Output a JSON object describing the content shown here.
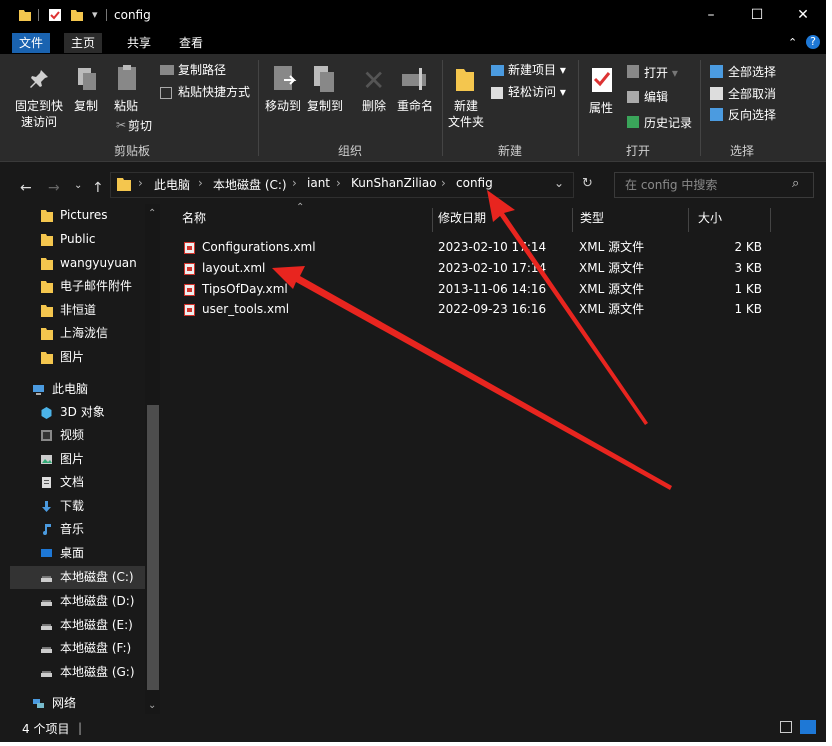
{
  "window": {
    "title": "config",
    "controls": [
      "–",
      "☐",
      "✕"
    ]
  },
  "menu": {
    "file": "文件",
    "home": "主页",
    "share": "共享",
    "view": "查看",
    "help": "?"
  },
  "ribbon": {
    "pin": "固定到快\n速访问",
    "copy": "复制",
    "paste": "粘贴",
    "copy_path": "复制路径",
    "paste_shortcut": "粘贴快捷方式",
    "cut": "剪切",
    "move_to": "移动到",
    "copy_to": "复制到",
    "delete": "删除",
    "rename": "重命名",
    "new_item": "新建项目",
    "easy_access": "轻松访问",
    "new_folder": "新建\n文件夹",
    "properties": "属性",
    "open": "打开",
    "edit": "编辑",
    "history": "历史记录",
    "select_all": "全部选择",
    "select_none": "全部取消",
    "invert": "反向选择",
    "groups": {
      "clipboard": "剪贴板",
      "organize": "组织",
      "new": "新建",
      "open": "打开",
      "select": "选择"
    }
  },
  "address": {
    "crumbs": [
      "此电脑",
      "本地磁盘 (C:)",
      "iant",
      "KunShanZiliao",
      "config"
    ],
    "search_placeholder": "在 config 中搜索"
  },
  "sidebar": {
    "items": [
      {
        "label": "Pictures",
        "icon": "folder-icon"
      },
      {
        "label": "Public",
        "icon": "folder-icon"
      },
      {
        "label": "wangyuyuan",
        "icon": "folder-icon"
      },
      {
        "label": "电子邮件附件",
        "icon": "folder-icon"
      },
      {
        "label": "非恒道",
        "icon": "folder-icon"
      },
      {
        "label": "上海泷信",
        "icon": "folder-icon"
      },
      {
        "label": "图片",
        "icon": "folder-icon"
      },
      {
        "label": "此电脑",
        "icon": "computer-icon"
      },
      {
        "label": "3D 对象",
        "icon": "3d-objects-icon"
      },
      {
        "label": "视频",
        "icon": "video-icon"
      },
      {
        "label": "图片",
        "icon": "pictures-icon"
      },
      {
        "label": "文档",
        "icon": "documents-icon"
      },
      {
        "label": "下载",
        "icon": "download-icon"
      },
      {
        "label": "音乐",
        "icon": "music-icon"
      },
      {
        "label": "桌面",
        "icon": "desktop-icon"
      },
      {
        "label": "本地磁盘 (C:)",
        "icon": "drive-icon"
      },
      {
        "label": "本地磁盘 (D:)",
        "icon": "drive-icon"
      },
      {
        "label": "本地磁盘 (E:)",
        "icon": "drive-icon"
      },
      {
        "label": "本地磁盘 (F:)",
        "icon": "drive-icon"
      },
      {
        "label": "本地磁盘 (G:)",
        "icon": "drive-icon"
      },
      {
        "label": "网络",
        "icon": "network-icon"
      }
    ]
  },
  "columns": {
    "name": "名称",
    "date": "修改日期",
    "type": "类型",
    "size": "大小"
  },
  "files": [
    {
      "name": "Configurations.xml",
      "date": "2023-02-10 17:14",
      "type": "XML 源文件",
      "size": "2 KB"
    },
    {
      "name": "layout.xml",
      "date": "2023-02-10 17:14",
      "type": "XML 源文件",
      "size": "3 KB"
    },
    {
      "name": "TipsOfDay.xml",
      "date": "2013-11-06 14:16",
      "type": "XML 源文件",
      "size": "1 KB"
    },
    {
      "name": "user_tools.xml",
      "date": "2022-09-23 16:16",
      "type": "XML 源文件",
      "size": "1 KB"
    }
  ],
  "status": {
    "count": "4 个项目"
  },
  "colors": {
    "accent": "#1a63b0",
    "folder": "#f4c64e",
    "arrow": "#e8251f"
  }
}
